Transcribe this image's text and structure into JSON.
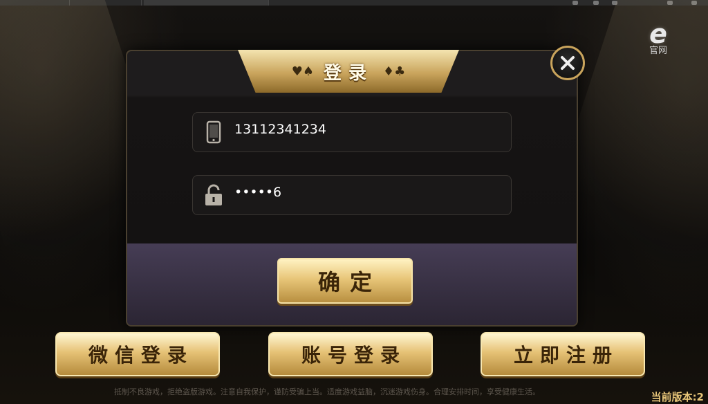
{
  "browser_tabs": [
    {
      "label": ""
    },
    {
      "label": ""
    },
    {
      "label": ""
    }
  ],
  "official_site": {
    "logo_letter": "e",
    "label": "官网"
  },
  "dialog": {
    "title": "登录",
    "title_suits_left": "♥♠",
    "title_suits_right": "♦♣",
    "phone_field": {
      "value": "13112341234",
      "icon": "phone-icon"
    },
    "password_field": {
      "value": "•••••6",
      "icon": "unlock-icon"
    },
    "confirm_label": "确定",
    "close_icon": "close-icon"
  },
  "bottom_buttons": {
    "wechat_login": "微信登录",
    "account_login": "账号登录",
    "register_now": "立即注册"
  },
  "notice": "抵制不良游戏，拒绝盗版游戏。注意自我保护，谨防受骗上当。适度游戏益脑，沉迷游戏伤身。合理安排时间，享受健康生活。",
  "version": "当前版本:2",
  "colors": {
    "gold": "#e8c679",
    "dark_gold": "#3a2408",
    "panel": "#141212"
  }
}
